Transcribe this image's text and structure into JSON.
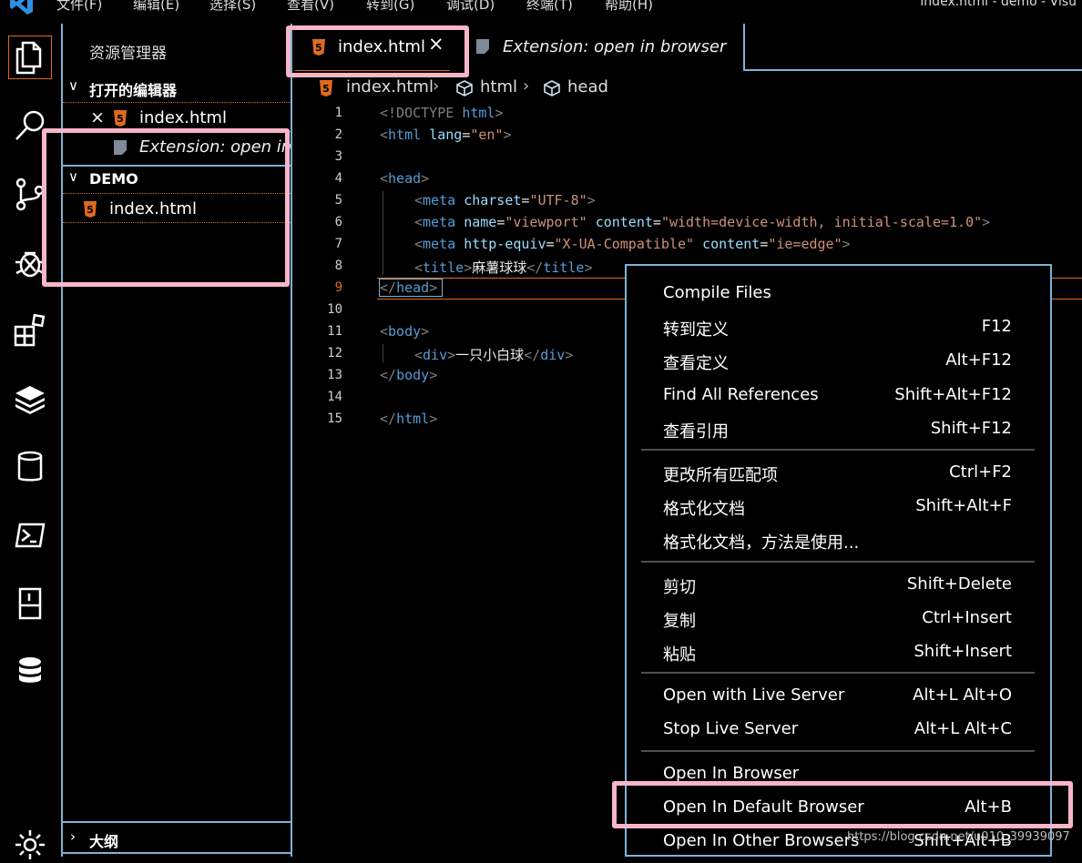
{
  "menubar": {
    "items": [
      "文件(F)",
      "编辑(E)",
      "选择(S)",
      "查看(V)",
      "转到(G)",
      "调试(D)",
      "终端(T)",
      "帮助(H)"
    ],
    "window_title": "index.html - demo - Visu"
  },
  "activity_icons": [
    "explorer-icon",
    "search-icon",
    "source-control-icon",
    "debug-icon",
    "extensions-icon",
    "layers-icon",
    "database-icon",
    "terminal-icon",
    "document-icon",
    "database-stack-icon",
    "settings-icon"
  ],
  "sidebar": {
    "title": "资源管理器",
    "open_editors": {
      "header": "打开的编辑器",
      "items": [
        {
          "label": "index.html",
          "icon": "html5-icon"
        },
        {
          "label": "Extension: open in..",
          "icon": "file-icon"
        }
      ]
    },
    "workspace": {
      "header": "DEMO",
      "items": [
        {
          "label": "index.html",
          "icon": "html5-icon"
        }
      ]
    },
    "outline_header": "大纲"
  },
  "tabs": [
    {
      "label": "index.html",
      "active": true
    },
    {
      "label": "Extension: open in browser",
      "active": false
    }
  ],
  "breadcrumb": [
    "index.html",
    "html",
    "head"
  ],
  "code": {
    "line_numbers": [
      "1",
      "2",
      "3",
      "4",
      "5",
      "6",
      "7",
      "8",
      "9",
      "10",
      "11",
      "12",
      "13",
      "14",
      "15"
    ],
    "line1": {
      "open": "<!DOCTYPE",
      "tag": "html",
      "close": ">"
    },
    "line2": {
      "open": "<",
      "tag": "html",
      "attr": "lang",
      "eq": "=",
      "val": "\"en\"",
      "close": ">"
    },
    "line4": {
      "open": "<",
      "tag": "head",
      "close": ">"
    },
    "line5": {
      "open": "<",
      "tag": "meta",
      "attr": "charset",
      "eq": "=",
      "val": "\"UTF-8\"",
      "close": ">"
    },
    "line6": {
      "open": "<",
      "tag": "meta",
      "attr1": "name",
      "eq1": "=",
      "val1": "\"viewport\"",
      "attr2": "content",
      "eq2": "=",
      "val2": "\"width=device-width, initial-scale=1.0\"",
      "close": ">"
    },
    "line7": {
      "open": "<",
      "tag": "meta",
      "attr1": "http-equiv",
      "eq1": "=",
      "val1": "\"X-UA-Compatible\"",
      "attr2": "content",
      "eq2": "=",
      "val2": "\"ie=edge\"",
      "close": ">"
    },
    "line8": {
      "open": "<",
      "tag": "title",
      "close": ">",
      "text": "麻薯球球",
      "open2": "</",
      "tag2": "title",
      "close2": ">"
    },
    "line9": {
      "open": "<",
      "slash": "/",
      "tag": "head",
      "close": ">"
    },
    "line11": {
      "open": "<",
      "tag": "body",
      "close": ">"
    },
    "line12": {
      "open": "<",
      "tag": "div",
      "close": ">",
      "text": "一只小白球",
      "open2": "</",
      "tag2": "div",
      "close2": ">"
    },
    "line13": {
      "open": "</",
      "tag": "body",
      "close": ">"
    },
    "line15": {
      "open": "</",
      "tag": "html",
      "close": ">"
    }
  },
  "context_menu": {
    "items": [
      {
        "label": "Compile Files",
        "key": ""
      },
      {
        "label": "转到定义",
        "key": "F12"
      },
      {
        "label": "查看定义",
        "key": "Alt+F12"
      },
      {
        "label": "Find All References",
        "key": "Shift+Alt+F12"
      },
      {
        "label": "查看引用",
        "key": "Shift+F12"
      },
      {
        "label": "更改所有匹配项",
        "key": "Ctrl+F2"
      },
      {
        "label": "格式化文档",
        "key": "Shift+Alt+F"
      },
      {
        "label": "格式化文档，方法是使用...",
        "key": ""
      },
      {
        "label": "剪切",
        "key": "Shift+Delete"
      },
      {
        "label": "复制",
        "key": "Ctrl+Insert"
      },
      {
        "label": "粘贴",
        "key": "Shift+Insert"
      },
      {
        "label": "Open with Live Server",
        "key": "Alt+L Alt+O"
      },
      {
        "label": "Stop Live Server",
        "key": "Alt+L Alt+C"
      },
      {
        "label": "Open In Browser",
        "key": ""
      },
      {
        "label": "Open In Default Browser",
        "key": "Alt+B"
      },
      {
        "label": "Open In Other Browsers",
        "key": "Shift+Alt+B"
      }
    ]
  },
  "watermark": "https://blog.csdn.net/u010_39939097",
  "colors": {
    "accent_orange": "#e06a1f",
    "border_blue": "#7fb2d8",
    "highlight_pink": "#f7b6c8"
  }
}
